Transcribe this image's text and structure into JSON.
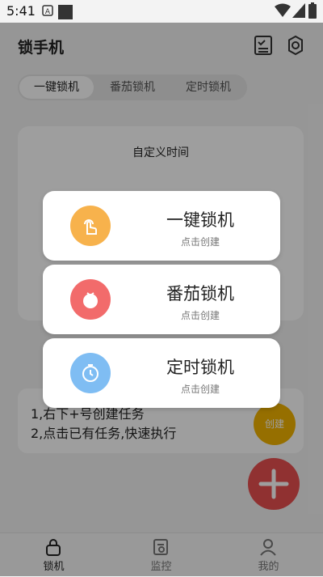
{
  "status_bar": {
    "time": "5:41"
  },
  "header": {
    "title": "锁手机"
  },
  "tabs": [
    {
      "label": "一键锁机"
    },
    {
      "label": "番茄锁机"
    },
    {
      "label": "定时锁机"
    }
  ],
  "card": {
    "title": "自定义时间"
  },
  "tips": {
    "line1": "1,右下+号创建任务",
    "line2": "2,点击已有任务,快速执行",
    "create_label": "创建"
  },
  "bottom_nav": [
    {
      "label": "锁机"
    },
    {
      "label": "监控"
    },
    {
      "label": "我的"
    }
  ],
  "popup_options": [
    {
      "title": "一键锁机",
      "subtitle": "点击创建",
      "icon": "touch-hand-icon",
      "color": "#f7b24c"
    },
    {
      "title": "番茄锁机",
      "subtitle": "点击创建",
      "icon": "tomato-icon",
      "color": "#f26b6b"
    },
    {
      "title": "定时锁机",
      "subtitle": "点击创建",
      "icon": "stopwatch-icon",
      "color": "#58a8f0"
    }
  ]
}
